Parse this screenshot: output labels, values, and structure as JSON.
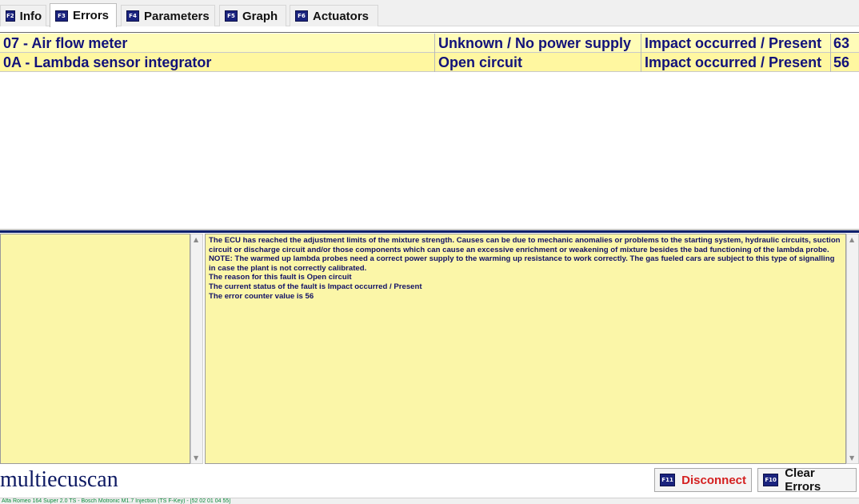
{
  "tabs": [
    {
      "key": "F2",
      "label": "Info"
    },
    {
      "key": "F3",
      "label": "Errors"
    },
    {
      "key": "F4",
      "label": "Parameters"
    },
    {
      "key": "F5",
      "label": "Graph"
    },
    {
      "key": "F6",
      "label": "Actuators"
    }
  ],
  "active_tab": "Errors",
  "errors": [
    {
      "name": "07 - Air flow meter",
      "type": "Unknown / No power supply",
      "status": "Impact occurred / Present",
      "count": "63"
    },
    {
      "name": "0A - Lambda sensor integrator",
      "type": "Open circuit",
      "status": "Impact occurred / Present",
      "count": "56"
    }
  ],
  "description": {
    "lines": [
      "The ECU has reached the adjustment limits of the mixture strength. Causes can be due to mechanic anomalies or problems to the starting system, hydraulic circuits, suction circuit or discharge circuit and/or those components which can cause an excessive enrichment or weakening of mixture besides the bad functioning of the lambda probe.",
      "NOTE: The warmed up lambda probes need a correct power supply to the warming up resistance to work correctly. The gas fueled cars are subject to this type of signalling in case the plant is not correctly calibrated.",
      "The reason for this fault is Open circuit",
      "The current status of the fault is Impact occurred / Present",
      "The error counter value is 56"
    ]
  },
  "logo": "multiecuscan",
  "buttons": {
    "disconnect": {
      "key": "F11",
      "label": "Disconnect"
    },
    "clear": {
      "key": "F10",
      "label": "Clear Errors"
    }
  },
  "statusbar": "Alfa Romeo 164 Super 2.0 TS - Bosch Motronic M1.7 Injection (TS F-Key) - [52 02 01 04 55]",
  "colors": {
    "row_bg": "#fffcb0",
    "text_navy": "#12127a",
    "pane_bg": "#fbf6a8",
    "fkey_bg": "#1a237e",
    "disconnect_red": "#d42020"
  }
}
